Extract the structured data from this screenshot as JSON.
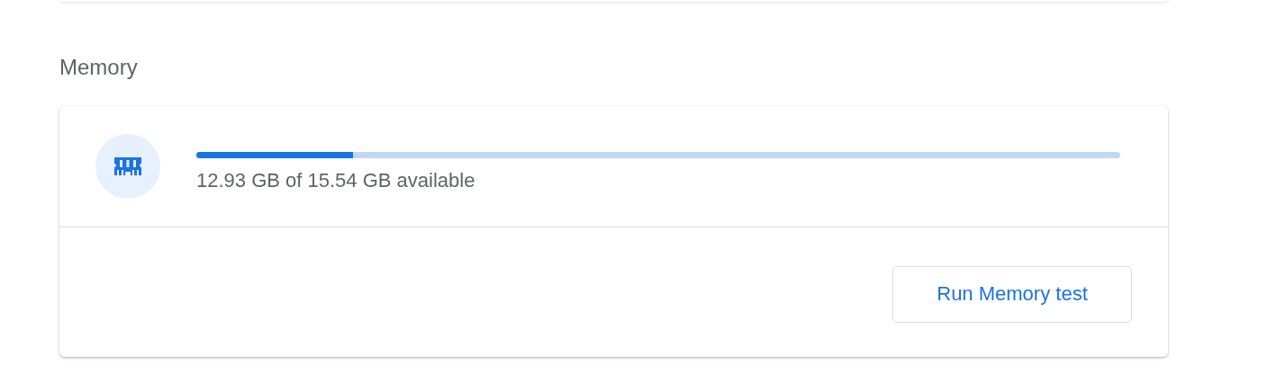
{
  "section_title": "Memory",
  "memory": {
    "level": 0.17,
    "reading": "12.93 GB of 15.54 GB available"
  },
  "buttons": [
    {
      "label": "Run Memory test"
    }
  ]
}
